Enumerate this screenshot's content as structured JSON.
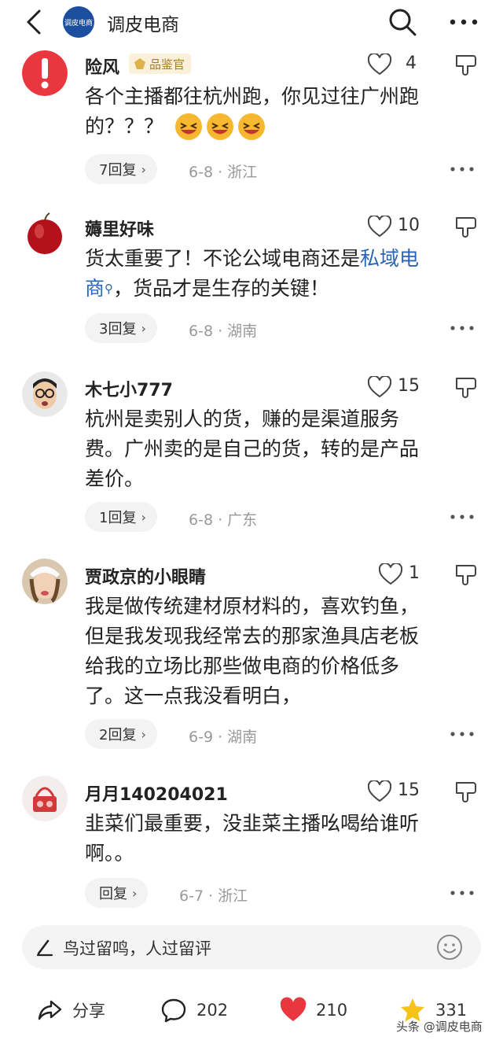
{
  "header": {
    "logo_text": "调皮电商",
    "title": "调皮电商",
    "icons": [
      "back-arrow-icon",
      "search-icon",
      "more-icon"
    ]
  },
  "comments": [
    {
      "name": "险风",
      "badge": "品鉴官",
      "likes": "4",
      "text_lines": [
        "各个主播都往杭州跑，你见过往广州跑",
        "的？？？"
      ],
      "emojis": [
        "laughing-face-icon",
        "laughing-face-icon",
        "laughing-face-icon"
      ],
      "reply": "7回复",
      "meta": "6-8 · 浙江"
    },
    {
      "name": "薅里好味",
      "likes": "10",
      "text_line1_pre": "货太重要了！不论公域电商还是",
      "text_line1_link": "私域电",
      "text_line2_link": "商",
      "text_line2_post": "，货品才是生存的关键！",
      "reply": "3回复",
      "meta": "6-8 · 湖南"
    },
    {
      "name": "木七小777",
      "likes": "15",
      "text_lines": [
        "杭州是卖别人的货，赚的是渠道服务",
        "费。广州卖的是自己的货，转的是产品",
        "差价。"
      ],
      "reply": "1回复",
      "meta": "6-8 · 广东"
    },
    {
      "name": "贾政京的小眼睛",
      "likes": "1",
      "text_lines": [
        "我是做传统建材原材料的，喜欢钓鱼，",
        "但是我发现我经常去的那家渔具店老板",
        "给我的立场比那些做电商的价格低多",
        "了。这一点我没看明白，"
      ],
      "reply": "2回复",
      "meta": "6-9 · 湖南"
    },
    {
      "name": "月月140204021",
      "likes": "15",
      "text_lines": [
        "韭菜们最重要，没韭菜主播吆喝给谁听",
        "啊。。"
      ],
      "reply": "回复",
      "meta": "6-7 · 浙江"
    }
  ],
  "input": {
    "placeholder": "鸟过留鸣，人过留评"
  },
  "actions": {
    "share_label": "分享",
    "comments_count": "202",
    "likes_count": "210",
    "favorites_count": "331"
  },
  "watermark": "头条 @调皮电商",
  "colors": {
    "accent_red": "#e8373e",
    "link_blue": "#2a66b8",
    "badge_gold": "#a87a26",
    "star_yellow": "#f7c31b"
  }
}
